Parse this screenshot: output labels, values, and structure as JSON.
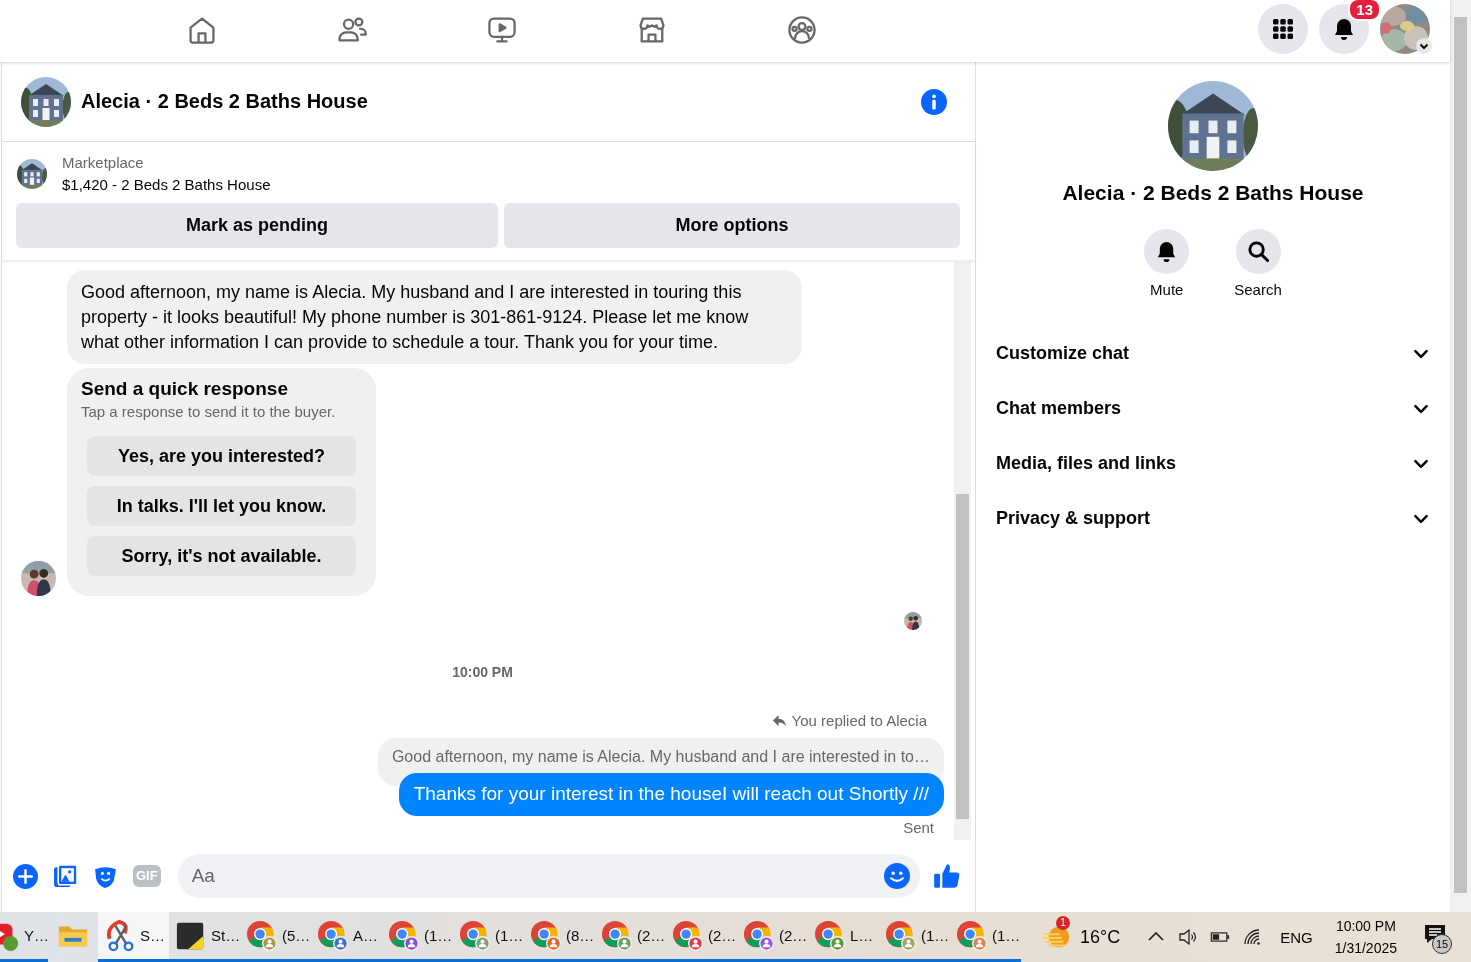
{
  "nav_tabs": [
    {
      "selected": false
    },
    {
      "selected": false
    },
    {
      "selected": false
    },
    {
      "selected": false
    },
    {
      "selected": false
    }
  ],
  "account": {
    "notifications_badge": "13"
  },
  "chat": {
    "title": "Alecia · 2 Beds 2 Baths House",
    "listing": {
      "source": "Marketplace",
      "summary": "$1,420 - 2 Beds 2 Baths House",
      "buttons": [
        "Mark as pending",
        "More options"
      ]
    },
    "messages": [
      {
        "kind": "incoming",
        "text": "Good afternoon, my name is Alecia. My husband and I are interested in touring this property - it looks beautiful! My phone number is 301-861-9124. Please let me know what other information I can provide to schedule a tour. Thank you for your time."
      },
      {
        "kind": "quick_responses",
        "title": "Send a quick response",
        "subtitle": "Tap a response to send it to the buyer.",
        "options": [
          "Yes, are you interested?",
          "In talks. I'll let you know.",
          "Sorry, it's not available."
        ]
      },
      {
        "kind": "read_receipt"
      },
      {
        "kind": "timestamp",
        "text": "10:00 PM"
      },
      {
        "kind": "reply_note",
        "text": "You replied to Alecia"
      },
      {
        "kind": "quote",
        "text": "Good afternoon, my name is Alecia. My husband and I are interested in to…"
      },
      {
        "kind": "outgoing",
        "text": "Thanks for your interest in the houseI will reach out Shortly ///"
      },
      {
        "kind": "status",
        "text": "Sent"
      }
    ],
    "composer": {
      "gif_label": "GIF",
      "placeholder": "Aa"
    }
  },
  "details": {
    "title": "Alecia · 2 Beds 2 Baths House",
    "actions": [
      {
        "label": "Mute"
      },
      {
        "label": "Search"
      }
    ],
    "sections": [
      {
        "label": "Customize chat",
        "expanded": false
      },
      {
        "label": "Chat members",
        "expanded": false
      },
      {
        "label": "Media, files and links",
        "expanded": false
      },
      {
        "label": "Privacy & support",
        "expanded": false
      }
    ]
  },
  "taskbar": {
    "apps": [
      {
        "kind": "web-app",
        "label": "Y…",
        "running": true,
        "selected": false
      },
      {
        "kind": "folder",
        "running": false,
        "selected": false
      },
      {
        "kind": "snipping",
        "label": "S…",
        "running": true,
        "selected": true
      },
      {
        "kind": "sticky",
        "label": "St…",
        "running": true,
        "selected": false
      },
      {
        "kind": "browser",
        "label": "(5…",
        "color": "#a89a4a",
        "running": true,
        "selected": false
      },
      {
        "kind": "browser",
        "label": "A…",
        "color": "#3a6fd8",
        "running": true,
        "selected": false
      },
      {
        "kind": "browser",
        "label": "(1…",
        "color": "#8a4ad8",
        "running": true,
        "selected": false
      },
      {
        "kind": "browser",
        "label": "(1…",
        "color": "#7fa07a",
        "running": true,
        "selected": false
      },
      {
        "kind": "browser",
        "label": "(8…",
        "color": "#e0662a",
        "running": true,
        "selected": false
      },
      {
        "kind": "browser",
        "label": "(2…",
        "color": "#6f9a66",
        "running": true,
        "selected": false
      },
      {
        "kind": "browser",
        "label": "(2…",
        "color": "#e03a4a",
        "running": true,
        "selected": false
      },
      {
        "kind": "browser",
        "label": "(2…",
        "color": "#9a5ad8",
        "running": true,
        "selected": false
      },
      {
        "kind": "browser",
        "label": "L…",
        "color": "#5a9a30",
        "running": true,
        "selected": false
      },
      {
        "kind": "browser",
        "label": "(1…",
        "color": "#a8a060",
        "running": true,
        "selected": false
      },
      {
        "kind": "browser",
        "label": "(1…",
        "color": "#e08050",
        "running": true,
        "selected": false
      }
    ],
    "tray": {
      "weather_badge": "1",
      "temperature": "16°C",
      "language": "ENG",
      "time": "10:00 PM",
      "date": "1/31/2025",
      "notification_count": "15"
    }
  }
}
